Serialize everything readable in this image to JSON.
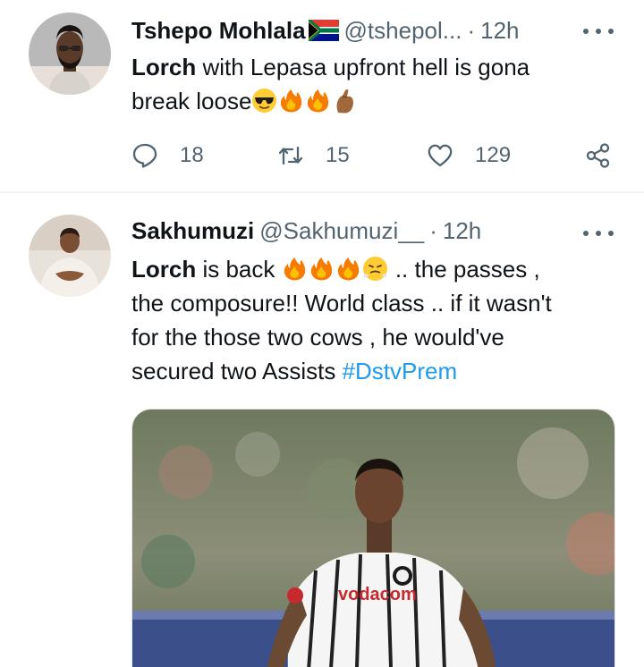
{
  "tweets": [
    {
      "name": "Tshepo Mohlala",
      "flag_icon": "south-africa-flag-icon",
      "handle": "@tshepol...",
      "separator": "·",
      "time": "12h",
      "text": {
        "bold": "Lorch",
        "line1": " with Lepasa upfront hell is gona",
        "line2": "break loose"
      },
      "emojis": [
        "sunglasses-face-emoji",
        "fire-emoji",
        "fire-emoji",
        "pinching-hand-emoji"
      ],
      "actions": {
        "replies": "18",
        "retweets": "15",
        "likes": "129"
      }
    },
    {
      "name": "Sakhumuzi",
      "handle": "@Sakhumuzi__",
      "separator": "·",
      "time": "12h",
      "text": {
        "bold": "Lorch",
        "line1a": " is back ",
        "line1b": " .. the passes ,",
        "line2": "the composure!! World class .. if it wasn't",
        "line3": "for the those two cows , he would've",
        "line4": "secured two Assists ",
        "hashtag": "#DstvPrem"
      },
      "emojis": [
        "fire-emoji",
        "fire-emoji",
        "fire-emoji",
        "face-with-steam-emoji"
      ]
    }
  ],
  "photo": {
    "icon": "football-player-photo",
    "sponsor_text": "vodacom"
  },
  "colors": {
    "text": "#0f1419",
    "secondary": "#536471",
    "link": "#1d9bf0",
    "divider": "#eff3f4"
  }
}
